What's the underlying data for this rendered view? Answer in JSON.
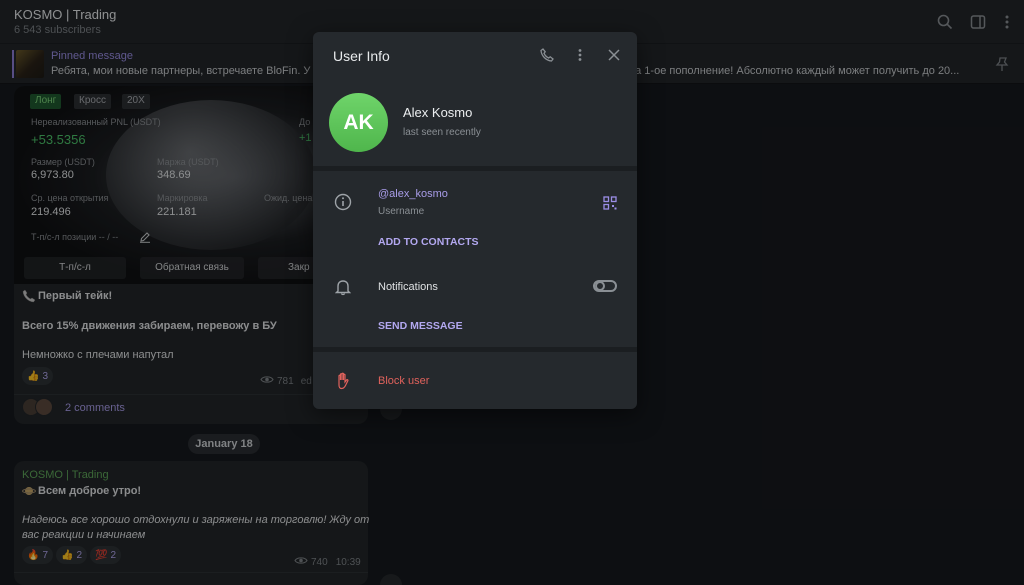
{
  "channel": {
    "title": "KOSMO | Trading",
    "subscribers": "6 543 subscribers"
  },
  "pinned": {
    "label": "Pinned message",
    "text": "Ребята, мои новые партнеры, встречаете BloFin.  У",
    "text_tail": "т за 1-ое пополнение!  Абсолютно каждый может получить до 20..."
  },
  "post1": {
    "photo": {
      "tags": [
        "Лонг",
        "Кросс",
        "20X"
      ],
      "unrealized_label": "Нереализованный PNL (USDT)",
      "unrealized_value": "+53.5356",
      "size_label": "Размер (USDT)",
      "size_value": "6,973.80",
      "margin_label": "Маржа (USDT)",
      "margin_value": "348.69",
      "entry_label": "Ср. цена открытия",
      "entry_value": "219.496",
      "mark_label": "Маркировка",
      "mark_value": "221.181",
      "liq_label": "Ожид. цена...",
      "liq_value": "1",
      "dox_label": "До",
      "dox_value": "+1",
      "tpsl_label": "Т-п/с-л позиции -- / --",
      "btn_tpsl": "Т-п/с-л",
      "btn_feedback": "Обратная связь",
      "btn_close": "Закр"
    },
    "line1": "Первый тейк!",
    "line2": "Всего 15% движения забираем, перевожу в БУ",
    "line3": "Немножко с плечами напутал",
    "reaction_count": "3",
    "views": "781",
    "edited": "ed",
    "comments": "2 comments"
  },
  "date_separator": "January 18",
  "post2": {
    "author": "KOSMO | Trading",
    "line1": "Всем доброе утро!",
    "line2": "Надеюсь все хорошо отдохнули и заряжены на торговлю! Жду от",
    "line3": "вас реакции и начинаем",
    "reactions": [
      {
        "emoji": "🔥",
        "count": "7"
      },
      {
        "emoji": "👍",
        "count": "2"
      },
      {
        "emoji": "💯",
        "count": "2"
      }
    ],
    "views": "740",
    "time": "10:39"
  },
  "modal": {
    "title": "User Info",
    "avatar_initials": "AK",
    "name": "Alex Kosmo",
    "status": "last seen recently",
    "username": "@alex_kosmo",
    "username_label": "Username",
    "add_contacts": "ADD TO CONTACTS",
    "notifications": "Notifications",
    "notifications_on": false,
    "send_message": "SEND MESSAGE",
    "block_user": "Block user"
  },
  "colors": {
    "accent": "#9b8ee6",
    "avatar_green": "#5cc458",
    "danger": "#e0625c",
    "author_green": "#5fa85a"
  }
}
